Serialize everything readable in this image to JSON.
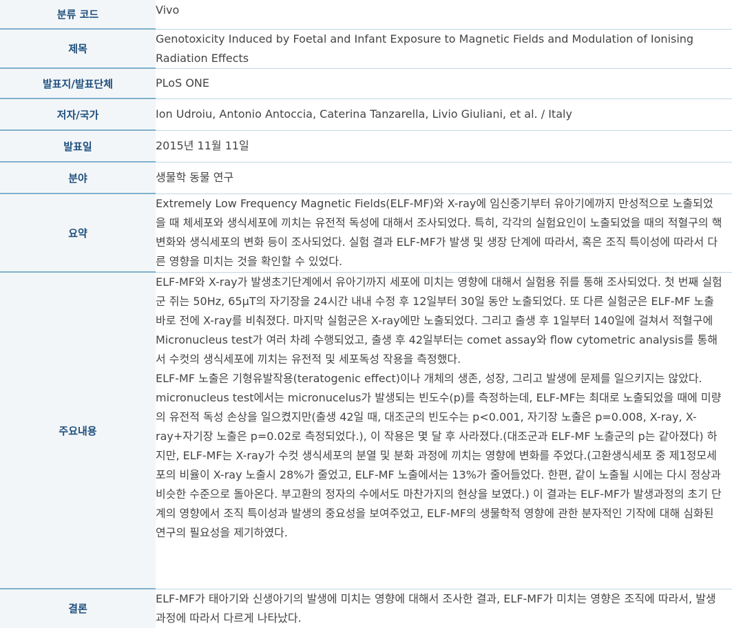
{
  "rows": [
    {
      "label": "분류 코드",
      "value": [
        "Vivo"
      ]
    },
    {
      "label": "제목",
      "value": [
        "Genotoxicity Induced by Foetal and Infant Exposure to Magnetic Fields and Modulation of Ionising Radiation Effects"
      ]
    },
    {
      "label": "발표지/발표단체",
      "value": [
        "PLoS ONE"
      ]
    },
    {
      "label": "저자/국가",
      "value": [
        "Ion Udroiu, Antonio Antoccia, Caterina Tanzarella, Livio Giuliani, et al. / Italy"
      ]
    },
    {
      "label": "발표일",
      "value": [
        "2015년 11월 11일"
      ]
    },
    {
      "label": "분야",
      "value": [
        "생물학 동물 연구"
      ]
    },
    {
      "label": "요약",
      "value": [
        "Extremely Low Frequency Magnetic Fields(ELF-MF)와 X-ray에 임신중기부터 유아기에까지 만성적으로 노출되었을 때 체세포와 생식세포에 끼치는 유전적 독성에 대해서 조사되었다. 특히, 각각의 실험요인이 노출되었을 때의 적혈구의 핵 변화와 생식세포의 변화 등이 조사되었다. 실험 결과 ELF-MF가 발생 및 생장 단계에 따라서, 혹은 조직 특이성에 따라서 다른 영향을 미치는 것을 확인할 수 있었다."
      ]
    },
    {
      "label": "주요내용",
      "value": [
        "ELF-MF와 X-ray가 발생초기단계에서 유아기까지 세포에 미치는 영향에 대해서 실험용 쥐를 통해 조사되었다. 첫 번째 실험군 쥐는 50Hz, 65μT의 자기장을 24시간 내내 수정 후 12일부터 30일 동안 노출되었다. 또 다른 실험군은 ELF-MF 노출 바로 전에 X-ray를 비춰졌다. 마지막 실험군은 X-ray에만 노출되었다. 그리고 출생 후 1일부터 140일에 걸쳐서 적혈구에 Micronucleus test가 여러 차례 수행되었고, 출생 후 42일부터는 comet assay와 flow cytometric analysis를 통해서 수컷의 생식세포에 끼치는 유전적 및 세포독성 작용을 측정했다.",
        "ELF-MF 노출은 기형유발작용(teratogenic effect)이나 개체의 생존, 성장, 그리고 발생에 문제를 일으키지는 않았다. micronucleus test에서는 micronucelus가 발생되는 빈도수(p)를 측정하는데, ELF-MF는 최대로 노출되었을 때에 미량의 유전적 독성 손상을 일으켰지만(출생 42일 때, 대조군의 빈도수는 p<0.001, 자기장 노출은 p=0.008, X-ray, X-ray+자기장 노출은 p=0.02로 측정되었다.), 이 작용은 몇 달 후 사라졌다.(대조군과 ELF-MF 노출군의 p는 같아졌다) 하지만, ELF-MF는 X-ray가 수컷 생식세포의 분열 및 분화 과정에 끼치는 영향에 변화를 주었다.(고환생식세포 중 제1정모세포의 비율이 X-ray 노출시 28%가 줄었고, ELF-MF 노출에서는 13%가 줄어들었다. 한편, 같이 노출될 시에는 다시 정상과 비슷한 수준으로 돌아온다. 부고환의 정자의 수에서도 마찬가지의 현상을 보였다.) 이 결과는 ELF-MF가 발생과정의 초기 단계의 영향에서 조직 특이성과 발생의 중요성을 보여주었고, ELF-MF의 생물학적 영향에 관한 분자적인 기작에 대해 심화된 연구의 필요성을 제기하였다."
      ]
    },
    {
      "label": "결론",
      "value": [
        "ELF-MF가 태아기와 신생아기의 발생에 미치는 영향에 대해서 조사한 결과, ELF-MF가 미치는 영향은 조직에 따라서, 발생과정에 따라서 다르게 나타났다."
      ]
    }
  ]
}
